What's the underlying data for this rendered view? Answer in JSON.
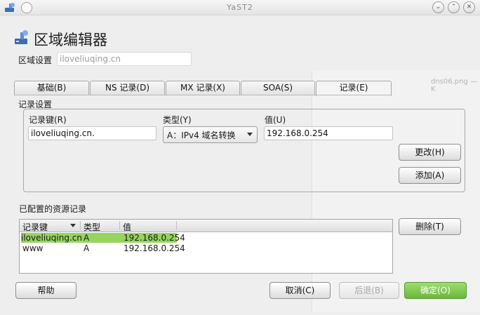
{
  "window": {
    "title": "YaST2"
  },
  "header": {
    "title": "区域编辑器"
  },
  "zone": {
    "label": "区域设置",
    "value": "iloveliuqing.cn"
  },
  "tabs": [
    {
      "label": "基础(B)"
    },
    {
      "label": "NS 记录(D)"
    },
    {
      "label": "MX 记录(X)"
    },
    {
      "label": "SOA(S)"
    },
    {
      "label": "记录(E)"
    }
  ],
  "record_settings": {
    "group_label": "记录设置",
    "key_label": "记录键(R)",
    "key_value": "iloveliuqing.cn.",
    "type_label": "类型(Y)",
    "type_value": "A：IPv4 域名转换",
    "value_label": "值(U)",
    "value_value": "192.168.0.254",
    "change_button": "更改(H)",
    "add_button": "添加(A)"
  },
  "configured": {
    "label": "已配置的资源记录",
    "columns": [
      "记录键",
      "类型",
      "值"
    ],
    "rows": [
      {
        "key": "iloveliuqing.cn.",
        "type": "A",
        "value": "192.168.0.254"
      },
      {
        "key": "www",
        "type": "A",
        "value": "192.168.0.254"
      }
    ],
    "delete_button": "删除(T)"
  },
  "footer": {
    "help": "帮助",
    "cancel": "取消(C)",
    "back": "后退(B)",
    "ok": "确定(O)"
  },
  "background_window": {
    "title": "dns06.png — K"
  },
  "colors": {
    "selection": "#97d45e",
    "primary_button": "#6bb83a"
  }
}
